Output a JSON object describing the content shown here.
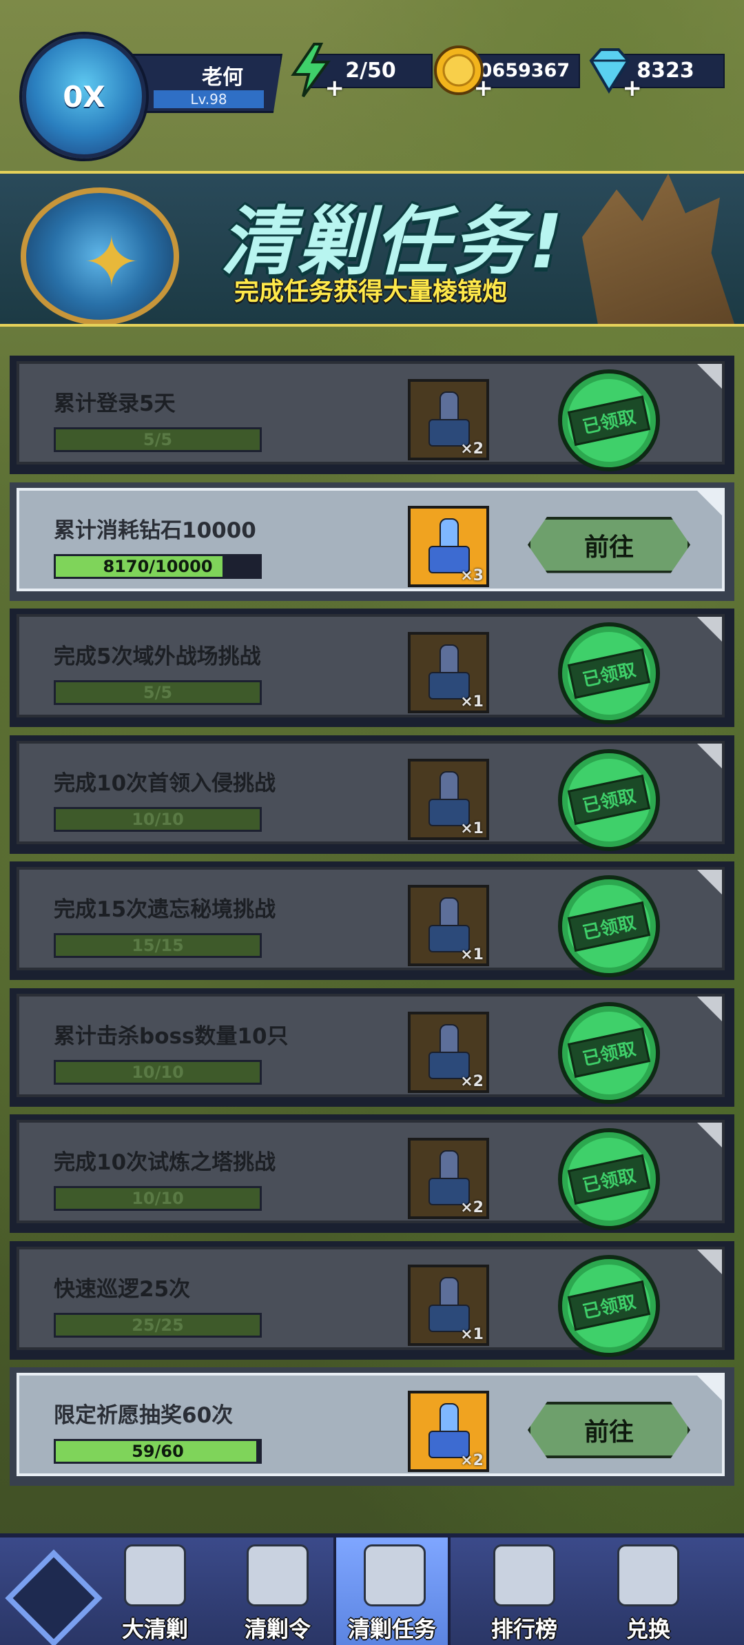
{
  "player": {
    "avatar_label": "0X",
    "name": "老何",
    "level": "Lv.98"
  },
  "resources": [
    {
      "name": "energy",
      "icon": "lightning-icon",
      "value": "2/50",
      "color": "#3fd06a"
    },
    {
      "name": "gold",
      "icon": "coin-icon",
      "value": "10659367",
      "color": "#f2b41c"
    },
    {
      "name": "diamond",
      "icon": "diamond-icon",
      "value": "8323",
      "color": "#5ad0f0"
    }
  ],
  "banner": {
    "title": "清剿任务!",
    "subtitle": "完成任务获得大量棱镜炮"
  },
  "tasks": [
    {
      "title": "累计登录5天",
      "progress": "5/5",
      "fill": 1.0,
      "reward_count": "×2",
      "status": "claimed",
      "status_label": "已领取"
    },
    {
      "title": "累计消耗钻石10000",
      "progress": "8170/10000",
      "fill": 0.817,
      "reward_count": "×3",
      "status": "goto",
      "status_label": "前往"
    },
    {
      "title": "完成5次域外战场挑战",
      "progress": "5/5",
      "fill": 1.0,
      "reward_count": "×1",
      "status": "claimed",
      "status_label": "已领取"
    },
    {
      "title": "完成10次首领入侵挑战",
      "progress": "10/10",
      "fill": 1.0,
      "reward_count": "×1",
      "status": "claimed",
      "status_label": "已领取"
    },
    {
      "title": "完成15次遗忘秘境挑战",
      "progress": "15/15",
      "fill": 1.0,
      "reward_count": "×1",
      "status": "claimed",
      "status_label": "已领取"
    },
    {
      "title": "累计击杀boss数量10只",
      "progress": "10/10",
      "fill": 1.0,
      "reward_count": "×2",
      "status": "claimed",
      "status_label": "已领取"
    },
    {
      "title": "完成10次试炼之塔挑战",
      "progress": "10/10",
      "fill": 1.0,
      "reward_count": "×2",
      "status": "claimed",
      "status_label": "已领取"
    },
    {
      "title": "快速巡逻25次",
      "progress": "25/25",
      "fill": 1.0,
      "reward_count": "×1",
      "status": "claimed",
      "status_label": "已领取"
    },
    {
      "title": "限定祈愿抽奖60次",
      "progress": "59/60",
      "fill": 0.983,
      "reward_count": "×2",
      "status": "goto",
      "status_label": "前往"
    }
  ],
  "nav": {
    "tabs": [
      {
        "label": "大清剿",
        "icon": "monster-icon",
        "active": false
      },
      {
        "label": "清剿令",
        "icon": "token-icon",
        "active": false
      },
      {
        "label": "清剿任务",
        "icon": "task-icon",
        "active": true
      },
      {
        "label": "排行榜",
        "icon": "trophy-icon",
        "active": false
      },
      {
        "label": "兑换",
        "icon": "exchange-icon",
        "active": false
      }
    ]
  }
}
